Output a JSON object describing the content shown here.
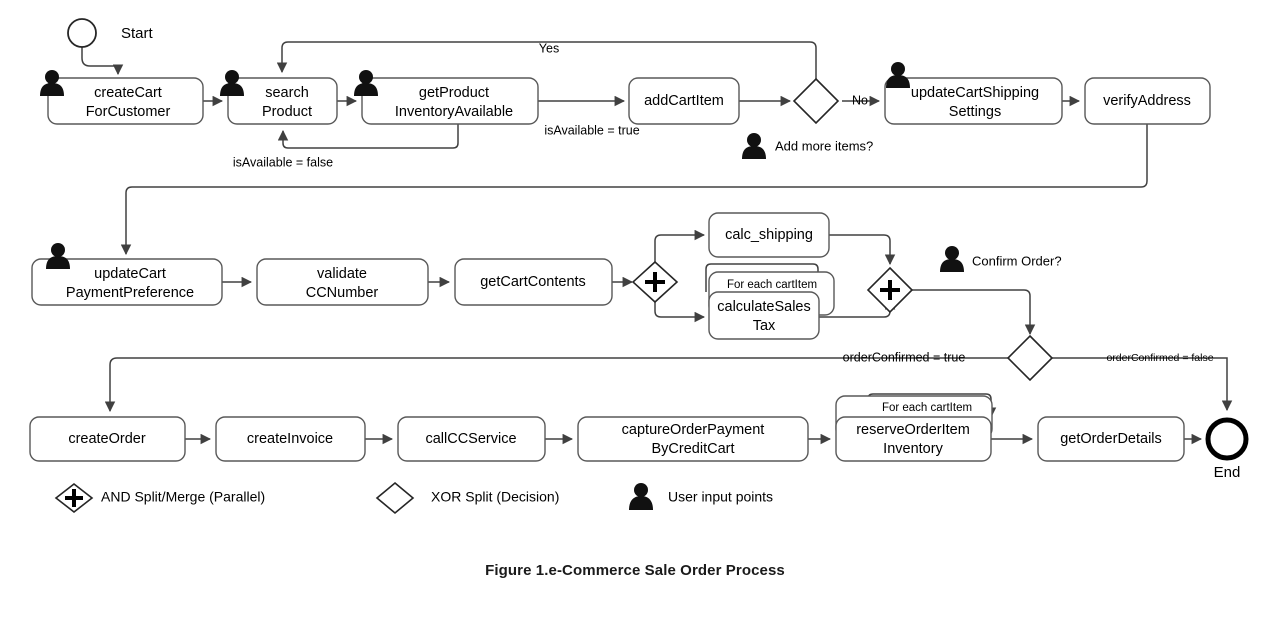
{
  "figure": {
    "caption": "Figure 1.e-Commerce Sale Order Process"
  },
  "events": {
    "start": {
      "label": "Start",
      "name": "start-event"
    },
    "end": {
      "label": "End",
      "name": "end-event"
    }
  },
  "tasks": {
    "create_cart": {
      "line1": "createCart",
      "line2": "ForCustomer",
      "user_input": true
    },
    "search_product": {
      "line1": "search",
      "line2": "Product",
      "user_input": true
    },
    "get_product_inventory": {
      "line1": "getProduct",
      "line2": "InventoryAvailable",
      "user_input": true
    },
    "add_cart_item": {
      "line1": "addCartItem",
      "line2": "",
      "user_input": false
    },
    "update_cart_shipping": {
      "line1": "updateCartShipping",
      "line2": "Settings",
      "user_input": true
    },
    "verify_address": {
      "line1": "verifyAddress",
      "line2": "",
      "user_input": false
    },
    "update_cart_payment": {
      "line1": "updateCart",
      "line2": "PaymentPreference",
      "user_input": true
    },
    "validate_cc": {
      "line1": "validate",
      "line2": "CCNumber",
      "user_input": false
    },
    "get_cart_contents": {
      "line1": "getCartContents",
      "line2": "",
      "user_input": false
    },
    "calc_shipping": {
      "line1": "calc_shipping",
      "line2": "",
      "user_input": false
    },
    "calculate_sales_tax": {
      "line1": "calculateSales",
      "line2": "Tax",
      "user_input": false,
      "loop_label": "For each cartItem"
    },
    "create_order": {
      "line1": "createOrder",
      "line2": "",
      "user_input": false
    },
    "create_invoice": {
      "line1": "createInvoice",
      "line2": "",
      "user_input": false
    },
    "call_cc_service": {
      "line1": "callCCService",
      "line2": "",
      "user_input": false
    },
    "capture_order_payment": {
      "line1": "captureOrderPayment",
      "line2": "ByCreditCart",
      "user_input": false
    },
    "reserve_order_item": {
      "line1": "reserveOrderItem",
      "line2": "Inventory",
      "user_input": false,
      "loop_label": "For each cartItem"
    },
    "get_order_details": {
      "line1": "getOrderDetails",
      "line2": "",
      "user_input": false
    }
  },
  "gateways": {
    "add_more_items": {
      "type": "xor",
      "annotation": "Add more items?",
      "user_input": true
    },
    "and_split": {
      "type": "and",
      "annotation": ""
    },
    "and_merge": {
      "type": "and",
      "annotation": "Confirm Order?",
      "user_input": true
    },
    "order_confirmed": {
      "type": "xor",
      "annotation": ""
    }
  },
  "edge_labels": {
    "is_available_false": "isAvailable = false",
    "is_available_true": "isAvailable = true",
    "yes": "Yes",
    "no": "No",
    "order_confirmed_true": "orderConfirmed = true",
    "order_confirmed_false": "orderConfirmed = false"
  },
  "legend": [
    {
      "icon": "and-gateway-icon",
      "label": "AND Split/Merge (Parallel)"
    },
    {
      "icon": "xor-gateway-icon",
      "label": "XOR Split (Decision)"
    },
    {
      "icon": "user-icon",
      "label": "User input points"
    }
  ],
  "colors": {
    "task_stroke": "#595959",
    "edge_stroke": "#404040",
    "gateway_stroke": "#262626",
    "text": "#000000",
    "background": "#ffffff"
  }
}
